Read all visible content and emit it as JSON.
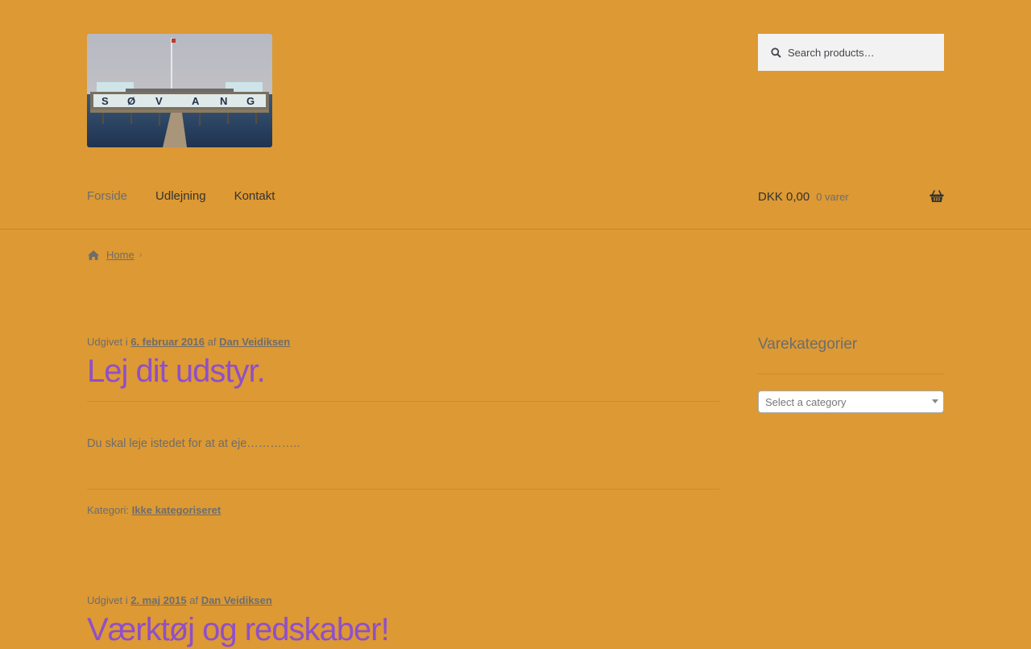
{
  "header": {
    "logo_text": "SØVANG",
    "search": {
      "placeholder": "Search products…"
    },
    "nav": [
      {
        "label": "Forside"
      },
      {
        "label": "Udlejning"
      },
      {
        "label": "Kontakt"
      }
    ],
    "cart": {
      "amount": "DKK 0,00",
      "count": "0 varer"
    }
  },
  "breadcrumb": {
    "home": "Home"
  },
  "posts": [
    {
      "meta_prefix": "Udgivet i",
      "date": "6. februar 2016",
      "meta_by": "af",
      "author": "Dan Veidiksen",
      "title": "Lej dit udstyr.",
      "content": "Du skal leje istedet for at at eje…………..",
      "category_label": "Kategori:",
      "category": "Ikke kategoriseret"
    },
    {
      "meta_prefix": "Udgivet i",
      "date": "2. maj 2015",
      "meta_by": "af",
      "author": "Dan Veidiksen",
      "title": "Værktøj og redskaber!"
    }
  ],
  "sidebar": {
    "widget_title": "Varekategorier",
    "select_placeholder": "Select a category"
  },
  "colors": {
    "background": "#dd9933",
    "title": "#8f4fc9",
    "text": "#6d6d6d"
  }
}
